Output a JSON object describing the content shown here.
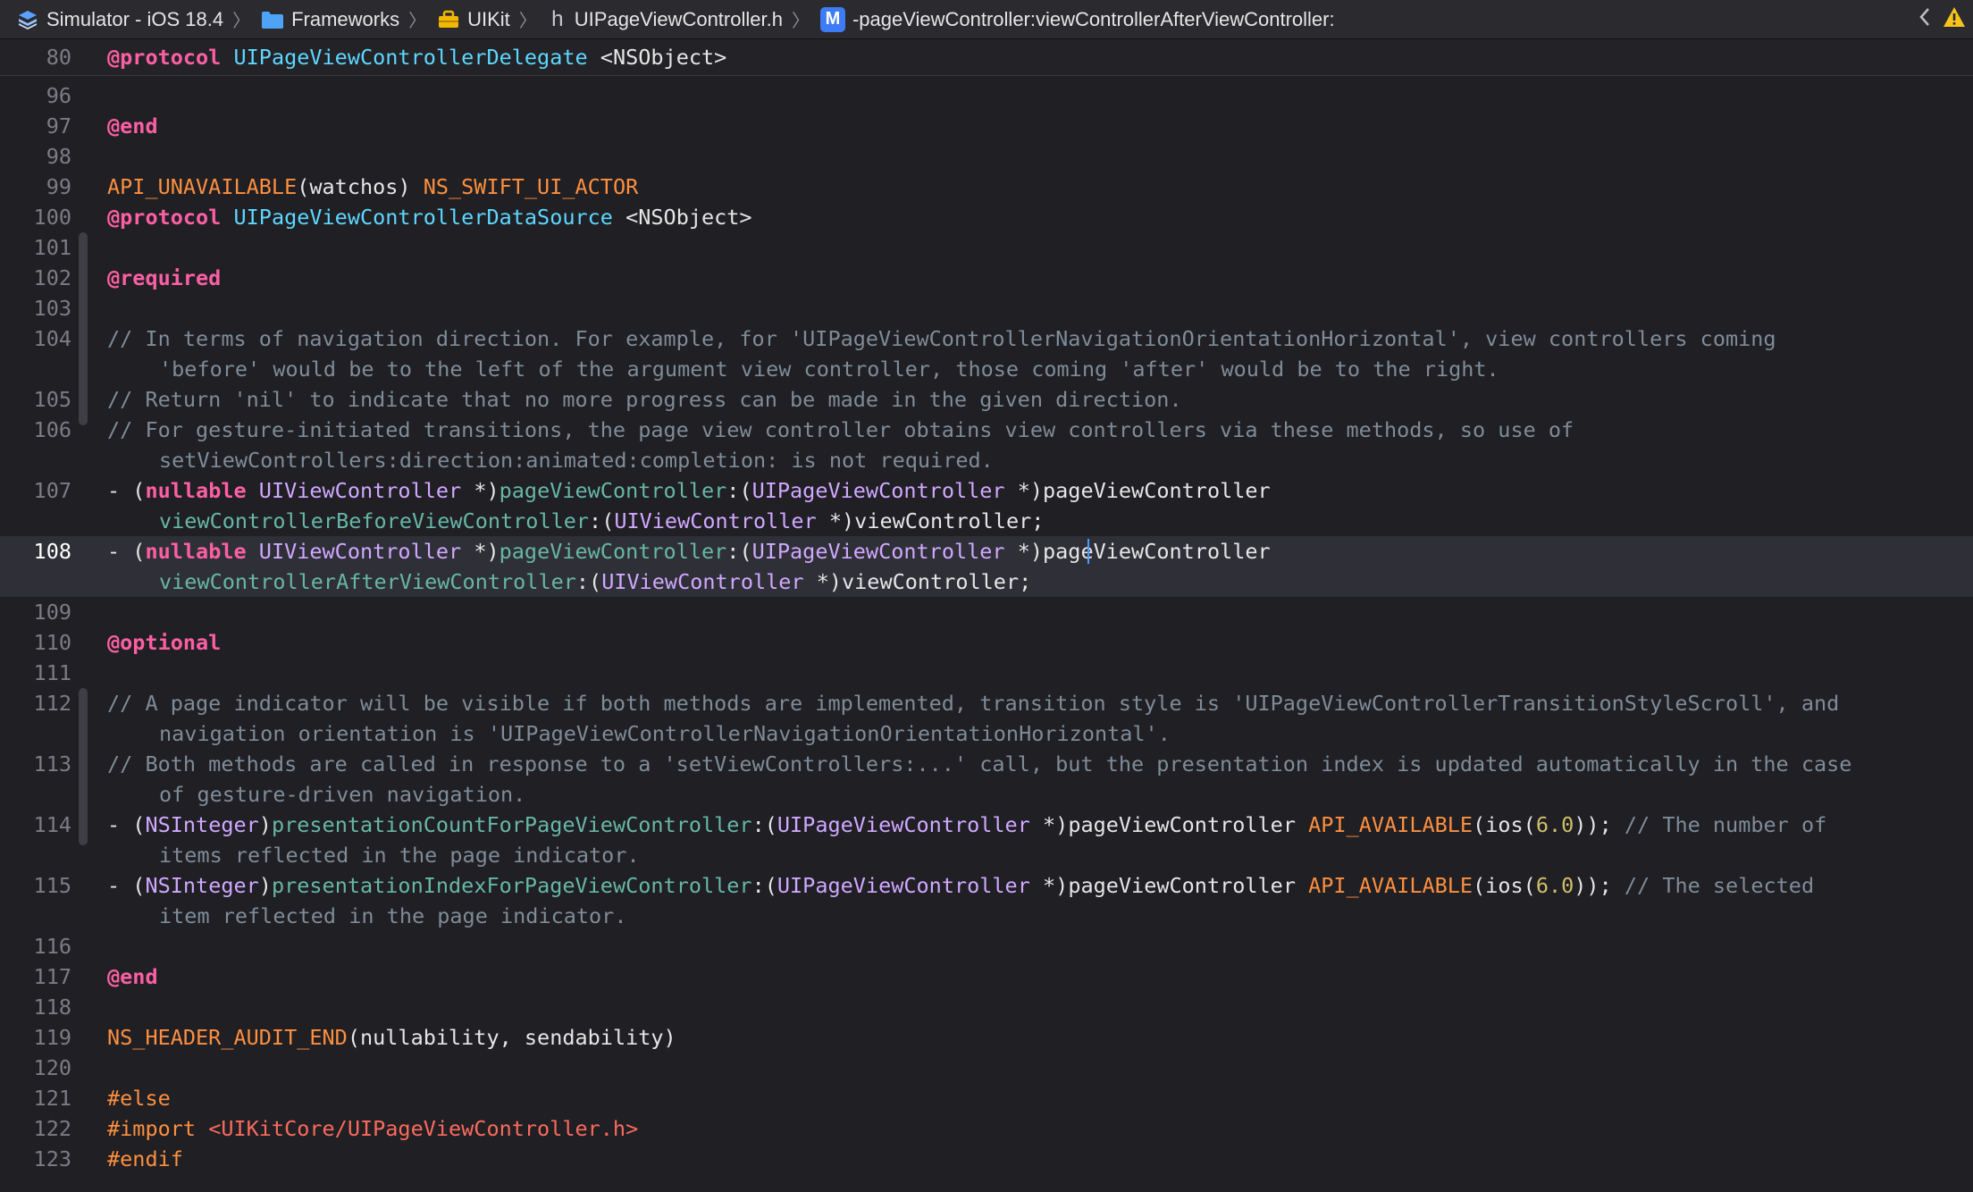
{
  "jumpbar": {
    "crumbs": [
      "Simulator - iOS 18.4",
      "Frameworks",
      "UIKit",
      "UIPageViewController.h",
      "-pageViewController:viewControllerAfterViewController:"
    ],
    "method_badge": "M",
    "header_glyph": "h"
  },
  "colors": {
    "keyword": "#fc5fa3",
    "type": "#d0a8ff",
    "class": "#5dd8ff",
    "method": "#67b7a4",
    "macro": "#fd8f3f",
    "comment": "#7f8c98",
    "number": "#d0bf69",
    "string": "#fc6a5d",
    "current_line": "#2f3037"
  },
  "editor": {
    "current_line": "108",
    "sticky_line": {
      "num": "80",
      "kw": "@protocol",
      "name": "UIPageViewControllerDelegate",
      "rest": " <NSObject>"
    },
    "ln": {
      "l96": "96",
      "l97": "97",
      "l98": "98",
      "l99": "99",
      "l100": "100",
      "l101": "101",
      "l102": "102",
      "l103": "103",
      "l104": "104",
      "l105": "105",
      "l106": "106",
      "l107": "107",
      "l108": "108",
      "l109": "109",
      "l110": "110",
      "l111": "111",
      "l112": "112",
      "l113": "113",
      "l114": "114",
      "l115": "115",
      "l116": "116",
      "l117": "117",
      "l118": "118",
      "l119": "119",
      "l120": "120",
      "l121": "121",
      "l122": "122",
      "l123": "123"
    },
    "t": {
      "end": "@end",
      "api_unavailable": "API_UNAVAILABLE",
      "watchos": "(watchos) ",
      "swift_ui_actor": "NS_SWIFT_UI_ACTOR",
      "protocol": "@protocol",
      "ds_name": "UIPageViewControllerDataSource",
      "nsobject": " <NSObject>",
      "required": "@required",
      "c104a": "// In terms of navigation direction. For example, for 'UIPageViewControllerNavigationOrientationHorizontal', view controllers coming",
      "c104b": "'before' would be to the left of the argument view controller, those coming 'after' would be to the right.",
      "c105": "// Return 'nil' to indicate that no more progress can be made in the given direction.",
      "c106a": "// For gesture-initiated transitions, the page view controller obtains view controllers via these methods, so use of",
      "c106b": "setViewControllers:direction:animated:completion: is not required.",
      "dash_open": "- (",
      "nullable": "nullable",
      "sp": " ",
      "uivc": "UIViewController",
      "star_close": " *)",
      "pvc_sel": "pageViewController",
      "colon_open": ":(",
      "uipvc": "UIPageViewController",
      "pvc_arg": "pageViewController",
      "before_sel": "viewControllerBeforeViewController",
      "after_sel": "viewControllerAfterViewController",
      "vc_arg": "viewController;",
      "optional": "@optional",
      "c112a": "// A page indicator will be visible if both methods are implemented, transition style is 'UIPageViewControllerTransitionStyleScroll', and",
      "c112b": "navigation orientation is 'UIPageViewControllerNavigationOrientationHorizontal'.",
      "c113a": "// Both methods are called in response to a 'setViewControllers:...' call, but the presentation index is updated automatically in the case",
      "c113b": "of gesture-driven navigation.",
      "nsinteger": "NSInteger",
      "close_paren": ")",
      "count_sel": "presentationCountForPageViewController",
      "index_sel": "presentationIndexForPageViewController",
      "pvc_arg_sp": "pageViewController ",
      "api_available": "API_AVAILABLE",
      "ios_open": "(ios(",
      "v60": "6.0",
      "close_semi": ")); ",
      "c114a": "// The number of",
      "c114b": "items reflected in the page indicator.",
      "c115a": "// The selected",
      "c115b": "item reflected in the page indicator.",
      "audit_end": "NS_HEADER_AUDIT_END",
      "audit_args": "(nullability, sendability)",
      "else": "#else",
      "import": "#import",
      "import_path": " <UIKitCore/UIPageViewController.h>",
      "endif": "#endif"
    }
  }
}
